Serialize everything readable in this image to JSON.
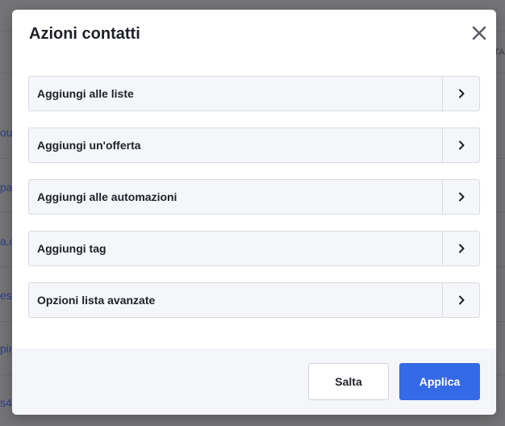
{
  "background": {
    "header_fragment": "TA",
    "row_fragments": [
      "out",
      "pa",
      "a.c",
      "es",
      "pin",
      "s4"
    ]
  },
  "modal": {
    "title": "Azioni contatti",
    "close_icon": "close-icon",
    "actions": [
      {
        "label": "Aggiungi alle liste",
        "icon": "chevron-right-icon"
      },
      {
        "label": "Aggiungi un'offerta",
        "icon": "chevron-right-icon"
      },
      {
        "label": "Aggiungi alle automazioni",
        "icon": "chevron-right-icon"
      },
      {
        "label": "Aggiungi tag",
        "icon": "chevron-right-icon"
      },
      {
        "label": "Opzioni lista avanzate",
        "icon": "chevron-right-icon"
      }
    ],
    "footer": {
      "skip_label": "Salta",
      "apply_label": "Applica"
    }
  },
  "colors": {
    "primary": "#356ae6",
    "text": "#1f2129",
    "row_background": "#f5f6fa",
    "border": "#d9dbe2",
    "overlay": "#747476"
  }
}
